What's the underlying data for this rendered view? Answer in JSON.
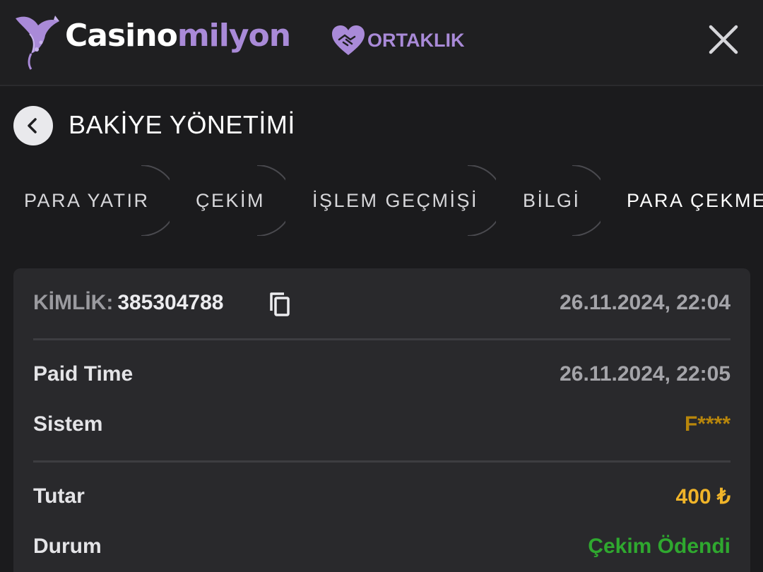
{
  "header": {
    "logo": {
      "text_white": "Casino",
      "text_purple": "milyon",
      "icon": "bird-icon"
    },
    "partner": {
      "label": "ORTAKLIK",
      "icon": "handshake-heart-icon"
    },
    "close_icon": "close-icon"
  },
  "title_bar": {
    "back_icon": "chevron-left-icon",
    "title": "BAKİYE YÖNETİMİ"
  },
  "tabs": [
    {
      "label": "PARA YATIR",
      "active": false
    },
    {
      "label": "ÇEKİM",
      "active": false
    },
    {
      "label": "İŞLEM GEÇMİŞİ",
      "active": false
    },
    {
      "label": "BİLGİ",
      "active": false
    },
    {
      "label": "PARA ÇEKME",
      "active": true
    }
  ],
  "transaction": {
    "id_label": "KİMLİK:",
    "id_value": "385304788",
    "copy_icon": "copy-icon",
    "created_at": "26.11.2024, 22:04",
    "rows": [
      {
        "label": "Paid Time",
        "value": "26.11.2024, 22:05"
      },
      {
        "label": "Sistem",
        "value": "F****"
      },
      {
        "label": "Tutar",
        "value": "400 ₺"
      },
      {
        "label": "Durum",
        "value": "Çekim Ödendi"
      }
    ]
  },
  "colors": {
    "background": "#1b1b1d",
    "card": "#29292c",
    "brand_purple": "#a98ad8",
    "system_value": "#b8860b",
    "amount_value": "#f0b429",
    "status_paid": "#2fa82f"
  }
}
